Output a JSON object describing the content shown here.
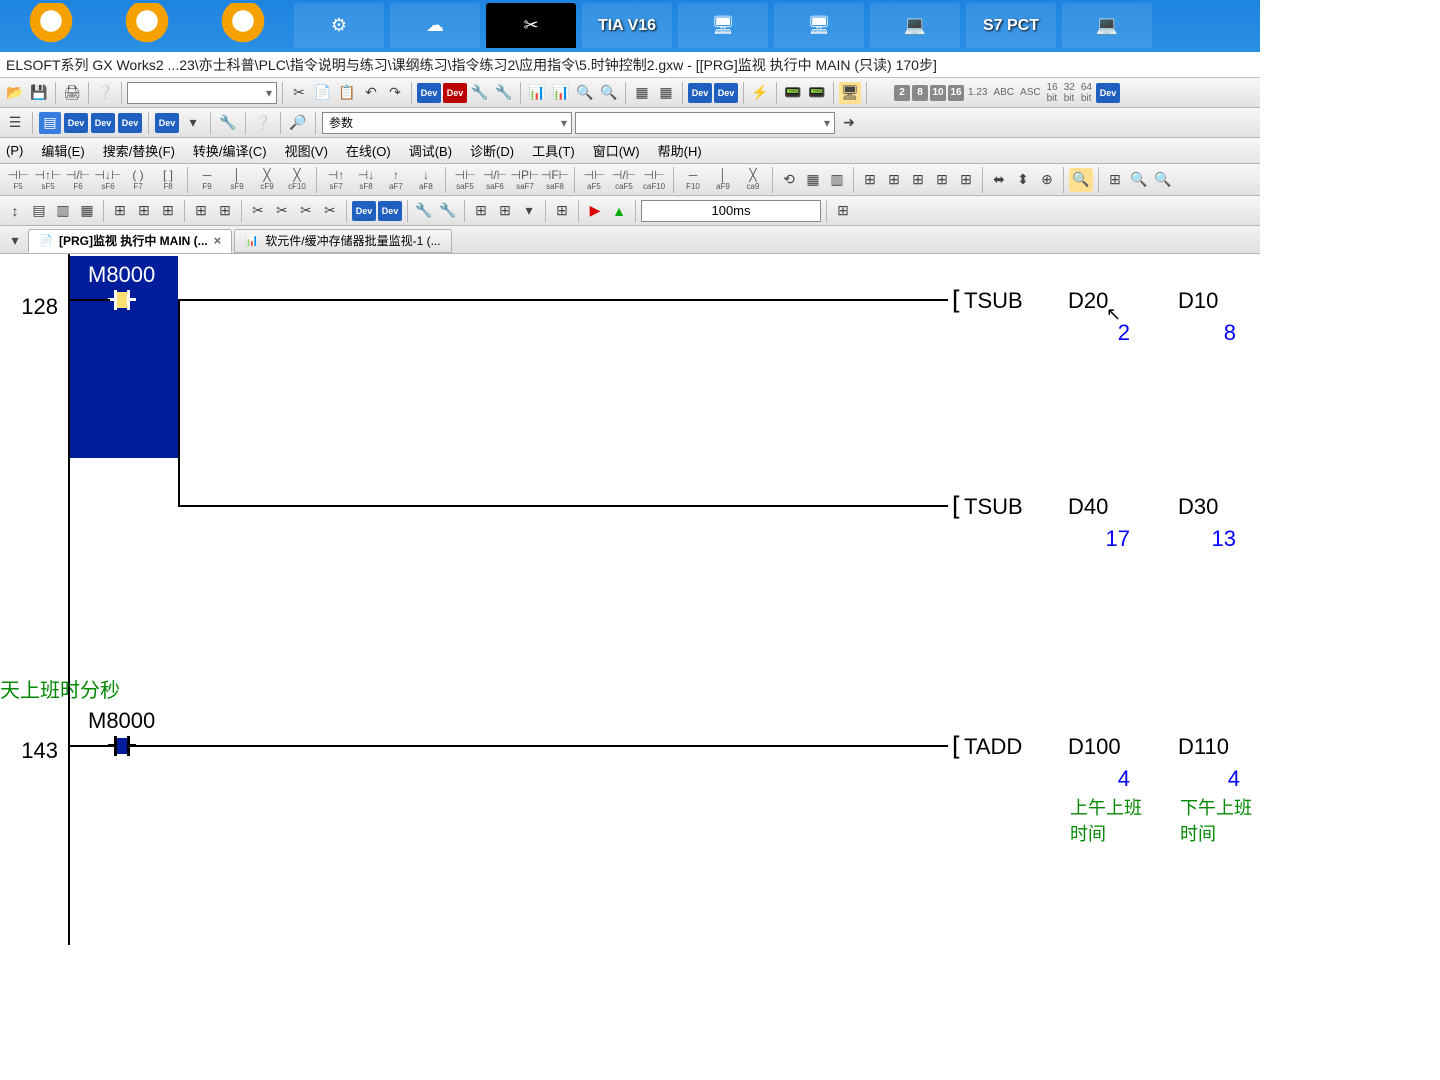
{
  "taskbar": {
    "items": [
      "egg",
      "egg",
      "egg",
      "app",
      "app",
      "app",
      "TIA V16",
      "app",
      "app",
      "app",
      "S7 PCT",
      "app"
    ]
  },
  "titlebar": "ELSOFT系列 GX Works2 ...23\\亦士科普\\PLC\\指令说明与练习\\课纲练习\\指令练习2\\应用指令\\5.时钟控制2.gxw - [[PRG]监视 执行中 MAIN (只读) 170步]",
  "toolbar1": {
    "dropdown": ""
  },
  "toolbar2": {
    "combo1": "参数",
    "combo2": ""
  },
  "menus": [
    "(P)",
    "编辑(E)",
    "搜索/替换(F)",
    "转换/编译(C)",
    "视图(V)",
    "在线(O)",
    "调试(B)",
    "诊断(D)",
    "工具(T)",
    "窗口(W)",
    "帮助(H)"
  ],
  "fkeys": [
    "F5",
    "sF5",
    "F6",
    "sF6",
    "F7",
    "F8",
    "F9",
    "sF9",
    "cF9",
    "cF10",
    "sF7",
    "sF8",
    "aF7",
    "aF8",
    "saF5",
    "saF6",
    "saF7",
    "saF8",
    "aF5",
    "caF5",
    "caF10",
    "F10",
    "aF9",
    "ca9"
  ],
  "runbar": {
    "time": "100ms"
  },
  "tabs": [
    {
      "label": "[PRG]监视 执行中 MAIN (...",
      "active": true,
      "closable": true
    },
    {
      "label": "软元件/缓冲存储器批量监视-1 (...",
      "active": false,
      "closable": false
    }
  ],
  "ladder": {
    "rungs": [
      {
        "step": "128",
        "contact": "M8000",
        "coils": [
          {
            "instr": "TSUB",
            "ops": [
              {
                "n": "D20",
                "v": "2"
              },
              {
                "n": "D10",
                "v": "8"
              }
            ]
          },
          {
            "instr": "TSUB",
            "ops": [
              {
                "n": "D40",
                "v": "17"
              },
              {
                "n": "D30",
                "v": "13"
              }
            ]
          }
        ]
      },
      {
        "step": "143",
        "contact": "M8000",
        "comment_above": "天上班时分秒",
        "coils": [
          {
            "instr": "TADD",
            "ops": [
              {
                "n": "D100",
                "v": "4",
                "cm": "上午上班\n时间"
              },
              {
                "n": "D110",
                "v": "4",
                "cm": "下午上班\n时间"
              }
            ]
          }
        ]
      }
    ]
  }
}
